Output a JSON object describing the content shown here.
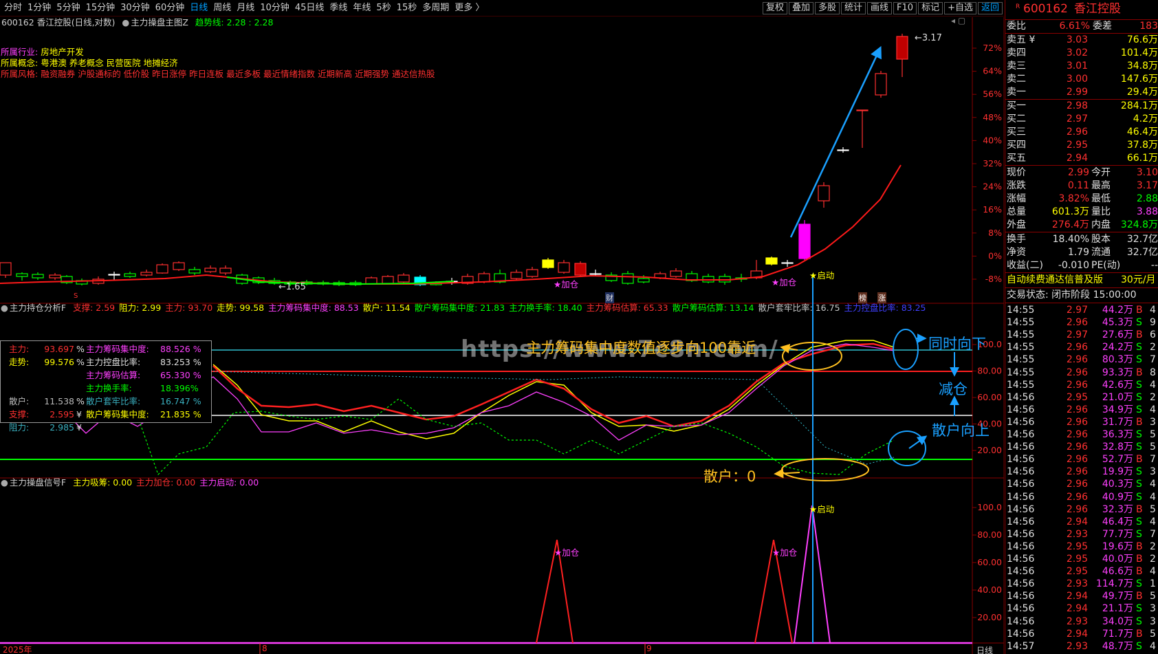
{
  "toolbar": {
    "periods": [
      "分时",
      "1分钟",
      "5分钟",
      "15分钟",
      "30分钟",
      "60分钟",
      "日线",
      "周线",
      "月线",
      "10分钟",
      "45日线",
      "季线",
      "年线",
      "5秒",
      "15秒",
      "多周期",
      "更多 〉"
    ],
    "active_period": "日线",
    "tools": [
      "复权",
      "叠加",
      "多股",
      "统计",
      "画线",
      "F10",
      "标记",
      "+自选",
      "返回"
    ]
  },
  "main_panel": {
    "stock_line": "600162 香江控股(日线,对数)",
    "indicator_name": "主力操盘主图Z",
    "trend_label": "趋势线: 2.28 : 2.28",
    "industry_label": "所属行业:",
    "industry_value": "房地产开发",
    "concept_label": "所属概念:",
    "concept_value": "粤港澳 养老概念 民营医院 地摊经济",
    "style_label": "所属风格:",
    "style_value": "融资融券 沪股通标的 低价股 昨日涨停 昨日连板 最近多板 最近情绪指数 近期新高 近期强势 通达信热股",
    "high_label": "3.17",
    "low_label": "1.65",
    "markers": [
      "★加仓",
      "★加仓",
      "★启动"
    ],
    "event_marks": [
      "财",
      "榜",
      "涨",
      "S"
    ],
    "y_ticks": [
      "72%",
      "64%",
      "56%",
      "48%",
      "40%",
      "32%",
      "24%",
      "16%",
      "8%",
      "0%",
      "-8%"
    ]
  },
  "mid_panel": {
    "title": "主力持仓分析F",
    "header_items": [
      {
        "text": "支撑: 2.59",
        "color": "#ff3030"
      },
      {
        "text": "阻力: 2.99",
        "color": "#ffff00"
      },
      {
        "text": "主力: 93.70",
        "color": "#ff3030"
      },
      {
        "text": "走势: 99.58",
        "color": "#ffff00"
      },
      {
        "text": "主力筹码集中度: 88.53",
        "color": "#ff40ff"
      },
      {
        "text": "散户: 11.54",
        "color": "#ffff00"
      },
      {
        "text": "散户筹码集中度: 21.83",
        "color": "#00ff00"
      },
      {
        "text": "主力换手率: 18.40",
        "color": "#00ff00"
      },
      {
        "text": "主力筹码估算: 65.33",
        "color": "#ff3030"
      },
      {
        "text": "散户筹码估算: 13.14",
        "color": "#00ff00"
      },
      {
        "text": "散户套牢比率: 16.75",
        "color": "#c8c8c8"
      },
      {
        "text": "主力控盘比率: 83.25",
        "color": "#4040ff"
      }
    ],
    "info": {
      "main_label": "主力:",
      "main_value": "93.697",
      "main_unit": "%",
      "trend_label": "走势:",
      "trend_value": "99.576",
      "trend_unit": "%",
      "retail_label": "散户:",
      "retail_value": "11.538",
      "retail_unit": "%",
      "support_label": "支撑:",
      "support_value": "2.595",
      "support_unit": "¥",
      "resist_label": "阻力:",
      "resist_value": "2.985",
      "resist_unit": "¥",
      "conc_label": "主力筹码集中度:",
      "conc_value": "88.526 %",
      "ctrl_label": "主力控盘比率:",
      "ctrl_value": "83.253 %",
      "est_label": "主力筹码估算:",
      "est_value": "65.330 %",
      "turn_label": "主力换手率:",
      "turn_value": "18.396%",
      "trap_label": "散户套牢比率:",
      "trap_value": "16.747 %",
      "rconc_label": "散户筹码集中度:",
      "rconc_value": "21.835 %"
    },
    "y_ticks": [
      "100.0",
      "80.00",
      "60.00",
      "40.00",
      "20.00"
    ]
  },
  "bottom_panel": {
    "title": "主力操盘信号F",
    "header_items": [
      {
        "text": "主力吸筹: 0.00",
        "color": "#ffff00"
      },
      {
        "text": "主力加仓: 0.00",
        "color": "#ff3030"
      },
      {
        "text": "主力启动: 0.00",
        "color": "#ff40ff"
      }
    ],
    "markers": [
      "★加仓",
      "★加仓",
      "★启动"
    ],
    "y_ticks": [
      "100.0",
      "80.00",
      "60.00",
      "40.00",
      "20.00"
    ]
  },
  "x_axis": {
    "labels": [
      "2025年",
      "8",
      "9"
    ],
    "right_label": "日线"
  },
  "annotations": {
    "watermark": "https://www.7c8n.com/",
    "conc_note": "主力筹码集中度数值逐步向100靠近",
    "same_down": "同时向下",
    "reduce": "减仓",
    "retail_up": "散户向上",
    "retail_zero": "散户：0"
  },
  "quote": {
    "code": "600162",
    "name": "香江控股",
    "weibi_label": "委比",
    "weibi_value": "6.61%",
    "weicha_label": "委差",
    "weicha_value": "183",
    "asks": [
      {
        "label": "卖五 ¥",
        "price": "3.03",
        "vol": "76.6万"
      },
      {
        "label": "卖四",
        "price": "3.02",
        "vol": "101.4万"
      },
      {
        "label": "卖三",
        "price": "3.01",
        "vol": "34.8万"
      },
      {
        "label": "卖二",
        "price": "3.00",
        "vol": "147.6万"
      },
      {
        "label": "卖一",
        "price": "2.99",
        "vol": "29.4万"
      }
    ],
    "bids": [
      {
        "label": "买一",
        "price": "2.98",
        "vol": "284.1万"
      },
      {
        "label": "买二",
        "price": "2.97",
        "vol": "4.2万"
      },
      {
        "label": "买三",
        "price": "2.96",
        "vol": "46.4万"
      },
      {
        "label": "买四",
        "price": "2.95",
        "vol": "37.8万"
      },
      {
        "label": "买五",
        "price": "2.94",
        "vol": "66.1万"
      }
    ],
    "stats": [
      {
        "l1": "现价",
        "v1": "2.99",
        "c1": "#ff3030",
        "l2": "今开",
        "v2": "3.10",
        "c2": "#ff3030"
      },
      {
        "l1": "涨跌",
        "v1": "0.11",
        "c1": "#ff3030",
        "l2": "最高",
        "v2": "3.17",
        "c2": "#ff3030"
      },
      {
        "l1": "涨幅",
        "v1": "3.82%",
        "c1": "#ff3030",
        "l2": "最低",
        "v2": "2.88",
        "c2": "#00ff00"
      },
      {
        "l1": "总量",
        "v1": "601.3万",
        "c1": "#ffff00",
        "l2": "量比",
        "v2": "3.88",
        "c2": "#ff40ff"
      },
      {
        "l1": "外盘",
        "v1": "276.4万",
        "c1": "#ff3030",
        "l2": "内盘",
        "v2": "324.8万",
        "c2": "#00ff00"
      }
    ],
    "stats2": [
      {
        "l1": "换手",
        "v1": "18.40%",
        "c1": "#e0e0e0",
        "l2": "股本",
        "v2": "32.7亿",
        "c2": "#e0e0e0"
      },
      {
        "l1": "净资",
        "v1": "1.79",
        "c1": "#e0e0e0",
        "l2": "流通",
        "v2": "32.7亿",
        "c2": "#e0e0e0"
      },
      {
        "l1": "收益(二)",
        "v1": "-0.010",
        "c1": "#e0e0e0",
        "l2": "PE(动)",
        "v2": "--",
        "c2": "#e0e0e0"
      }
    ],
    "ad_text": "自动续费通达信普及版",
    "ad_price": "30元/月",
    "trade_state": "交易状态: 闭市阶段 15:00:00",
    "ticks": [
      [
        "14:55",
        "2.97",
        "44.2万",
        "B",
        "4"
      ],
      [
        "14:55",
        "2.96",
        "45.3万",
        "S",
        "9"
      ],
      [
        "14:55",
        "2.97",
        "27.6万",
        "B",
        "6"
      ],
      [
        "14:55",
        "2.96",
        "24.2万",
        "S",
        "2"
      ],
      [
        "14:55",
        "2.96",
        "80.3万",
        "S",
        "7"
      ],
      [
        "14:55",
        "2.96",
        "93.3万",
        "B",
        "8"
      ],
      [
        "14:55",
        "2.96",
        "42.6万",
        "S",
        "4"
      ],
      [
        "14:56",
        "2.95",
        "21.0万",
        "S",
        "2"
      ],
      [
        "14:56",
        "2.96",
        "34.9万",
        "S",
        "4"
      ],
      [
        "14:56",
        "2.96",
        "31.7万",
        "B",
        "3"
      ],
      [
        "14:56",
        "2.96",
        "36.3万",
        "S",
        "5"
      ],
      [
        "14:56",
        "2.96",
        "32.8万",
        "S",
        "5"
      ],
      [
        "14:56",
        "2.96",
        "52.7万",
        "B",
        "7"
      ],
      [
        "14:56",
        "2.96",
        "19.9万",
        "S",
        "3"
      ],
      [
        "14:56",
        "2.96",
        "40.3万",
        "S",
        "4"
      ],
      [
        "14:56",
        "2.96",
        "40.9万",
        "S",
        "4"
      ],
      [
        "14:56",
        "2.96",
        "32.3万",
        "B",
        "5"
      ],
      [
        "14:56",
        "2.94",
        "46.4万",
        "S",
        "4"
      ],
      [
        "14:56",
        "2.93",
        "77.7万",
        "S",
        "7"
      ],
      [
        "14:56",
        "2.95",
        "19.6万",
        "B",
        "2"
      ],
      [
        "14:56",
        "2.95",
        "40.0万",
        "B",
        "2"
      ],
      [
        "14:56",
        "2.95",
        "46.6万",
        "B",
        "4"
      ],
      [
        "14:56",
        "2.93",
        "114.7万",
        "S",
        "1"
      ],
      [
        "14:56",
        "2.94",
        "49.7万",
        "B",
        "5"
      ],
      [
        "14:56",
        "2.94",
        "21.1万",
        "S",
        "3"
      ],
      [
        "14:56",
        "2.93",
        "34.0万",
        "S",
        "3"
      ],
      [
        "14:56",
        "2.94",
        "71.7万",
        "B",
        "5"
      ],
      [
        "14:57",
        "2.93",
        "48.7万",
        "S",
        "4"
      ]
    ]
  },
  "colors": {
    "up": "#ff3030",
    "down": "#00ff00",
    "accent": "#00a0ff",
    "grid": "#8a0000"
  }
}
